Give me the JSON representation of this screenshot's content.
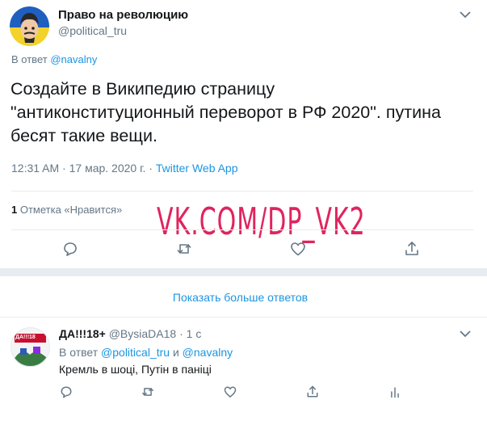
{
  "main_tweet": {
    "author_name": "Право на революцию",
    "author_handle": "@political_tru",
    "reply_prefix": "В ответ",
    "reply_to": "@navalny",
    "text_lines": [
      "Создайте в Википедию страницу",
      "\"антиконституционный переворот в РФ 2020\". путина",
      "бесят такие вещи."
    ],
    "time": "12:31 AM",
    "date": "17 мар. 2020 г.",
    "separator": "·",
    "source": "Twitter Web App",
    "likes_count": "1",
    "likes_label": "Отметка «Нравится»"
  },
  "watermark": "VK.COM/DP_VK2",
  "show_more": "Показать больше ответов",
  "reply_tweet": {
    "author_name": "ДА!!!18+",
    "author_handle": "@BysiaDA18",
    "separator": "·",
    "age": "1 с",
    "reply_prefix": "В ответ",
    "reply_to_1": "@political_tru",
    "reply_and": "и",
    "reply_to_2": "@navalny",
    "text": "Кремль в шоці, Путін в паніці",
    "avatar_text": "ДА!!!18"
  },
  "colors": {
    "link": "#1b95e0",
    "muted": "#657786",
    "divider": "#e6ecf0",
    "watermark": "#e0245e"
  }
}
